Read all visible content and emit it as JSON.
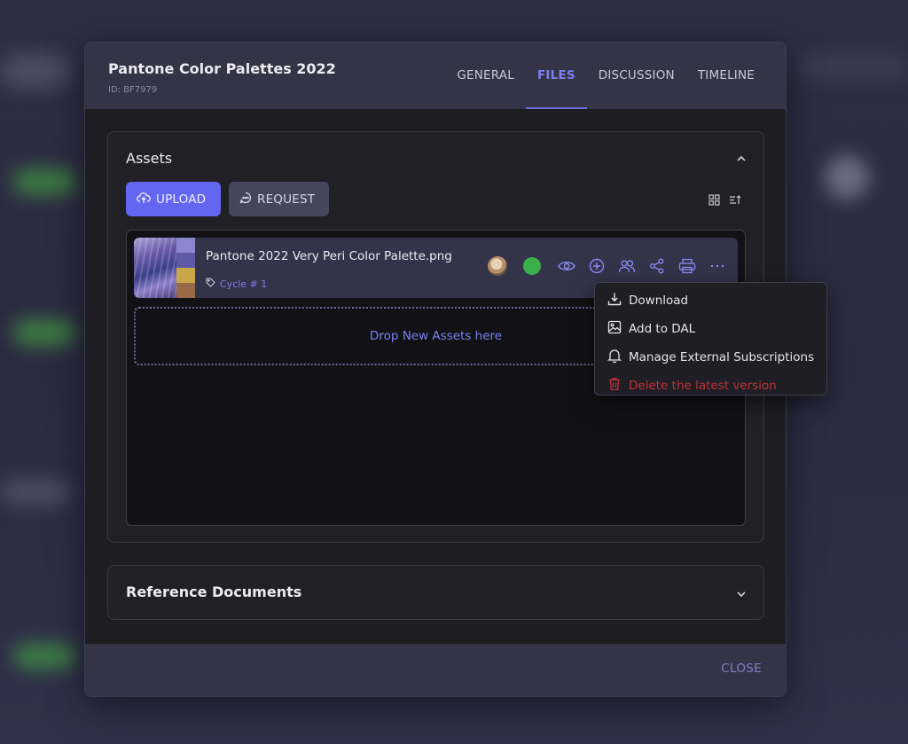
{
  "modal": {
    "title": "Pantone Color Palettes 2022",
    "id_label": "ID: BF7979",
    "tabs": [
      {
        "label": "GENERAL",
        "active": false
      },
      {
        "label": "FILES",
        "active": true
      },
      {
        "label": "DISCUSSION",
        "active": false
      },
      {
        "label": "TIMELINE",
        "active": false
      }
    ]
  },
  "assets": {
    "title": "Assets",
    "upload_label": "UPLOAD",
    "request_label": "REQUEST",
    "file": {
      "name": "Pantone 2022 Very Peri Color Palette.png",
      "tag": "Cycle # 1",
      "status_color": "#3bb04a",
      "swatch_colors": [
        "#8b87cf",
        "#5e5aa6",
        "#c9a64a",
        "#9a6a48"
      ]
    },
    "dropzone_label": "Drop New Assets here"
  },
  "context_menu": {
    "items": [
      {
        "label": "Download",
        "icon": "download-icon"
      },
      {
        "label": "Add to DAL",
        "icon": "image-icon"
      },
      {
        "label": "Manage External Subscriptions",
        "icon": "bell-icon"
      },
      {
        "label": "Delete the latest version",
        "icon": "trash-icon",
        "danger": true
      }
    ]
  },
  "reference_documents": {
    "title": "Reference Documents"
  },
  "footer": {
    "close_label": "CLOSE"
  },
  "colors": {
    "accent": "#6366f1",
    "danger": "#c0333a"
  }
}
